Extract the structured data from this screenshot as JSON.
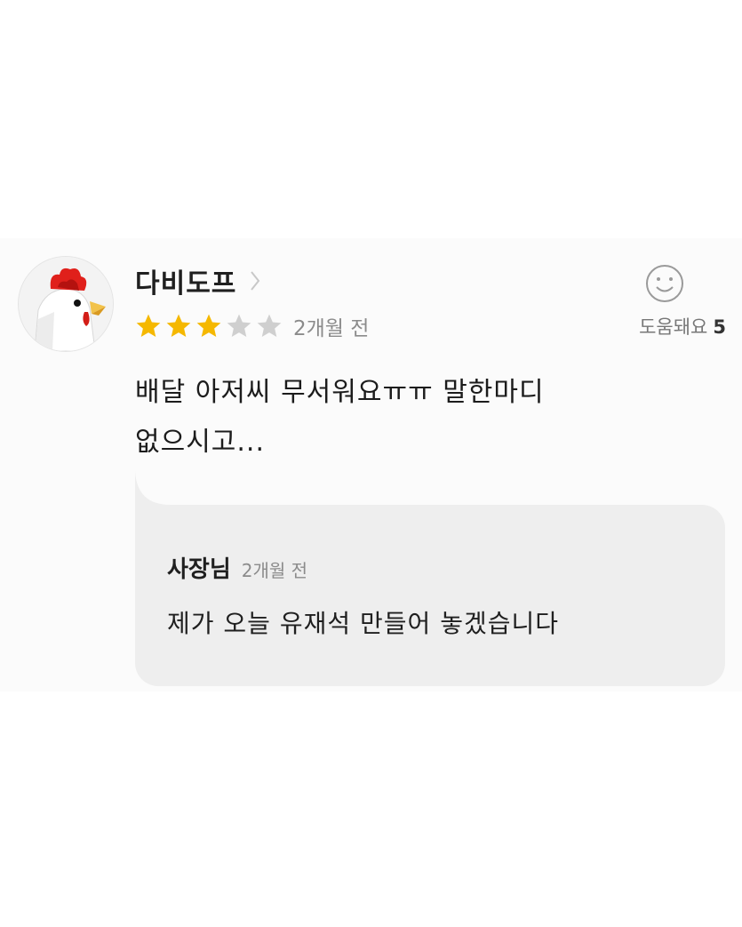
{
  "review": {
    "username": "다비도프",
    "rating": 3,
    "max_rating": 5,
    "time": "2개월 전",
    "body_line1": "배달 아저씨 무서워요ㅠㅠ 말한마디",
    "body_line2": "없으시고...",
    "helpful_label": "도움돼요",
    "helpful_count": "5"
  },
  "reply": {
    "author": "사장님",
    "time": "2개월 전",
    "text": "제가 오늘 유재석 만들어 놓겠습니다"
  },
  "icons": {
    "avatar": "chicken-avatar-icon",
    "chevron": "chevron-right-icon",
    "star": "star-icon",
    "helpful": "smile-face-icon"
  },
  "colors": {
    "star_filled": "#f5b800",
    "star_empty": "#cfcfcf",
    "reply_bg": "#eeeeee",
    "card_bg": "#fbfbfb"
  }
}
